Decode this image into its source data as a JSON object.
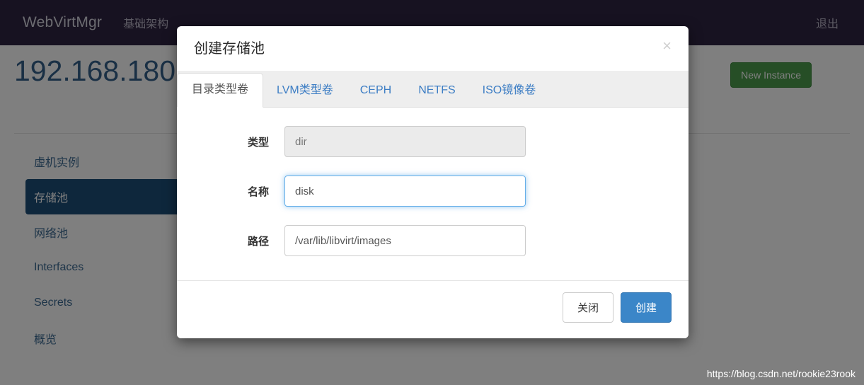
{
  "navbar": {
    "brand": "WebVirtMgr",
    "link": "基础架构",
    "logout": "退出"
  },
  "page": {
    "title": "192.168.180",
    "new_instance_label": "New Instance",
    "new_instance_color": "#4d9c4d",
    "title_color": "#34618b"
  },
  "sidebar": {
    "items": [
      {
        "label": "虚机实例",
        "active": false
      },
      {
        "label": "存储池",
        "active": true
      },
      {
        "label": "网络池",
        "active": false
      },
      {
        "label": "Interfaces",
        "active": false
      },
      {
        "label": "Secrets",
        "active": false
      },
      {
        "label": "概览",
        "active": false
      }
    ],
    "active_color": "#1d4e78"
  },
  "watermark": "https://blog.csdn.net/rookie23rook",
  "modal": {
    "title": "创建存储池",
    "close_glyph": "×",
    "tabs": [
      {
        "label": "目录类型卷",
        "active": true
      },
      {
        "label": "LVM类型卷",
        "active": false
      },
      {
        "label": "CEPH",
        "active": false
      },
      {
        "label": "NETFS",
        "active": false
      },
      {
        "label": "ISO镜像卷",
        "active": false
      }
    ],
    "fields": [
      {
        "label": "类型",
        "value": "dir",
        "placeholder": "",
        "state": "disabled"
      },
      {
        "label": "名称",
        "value": "disk",
        "placeholder": "",
        "state": "focused"
      },
      {
        "label": "路径",
        "value": "/var/lib/libvirt/images",
        "placeholder": "",
        "state": "normal"
      }
    ],
    "buttons": {
      "close": "关闭",
      "create": "创建",
      "primary_color": "#3b86c8"
    }
  }
}
